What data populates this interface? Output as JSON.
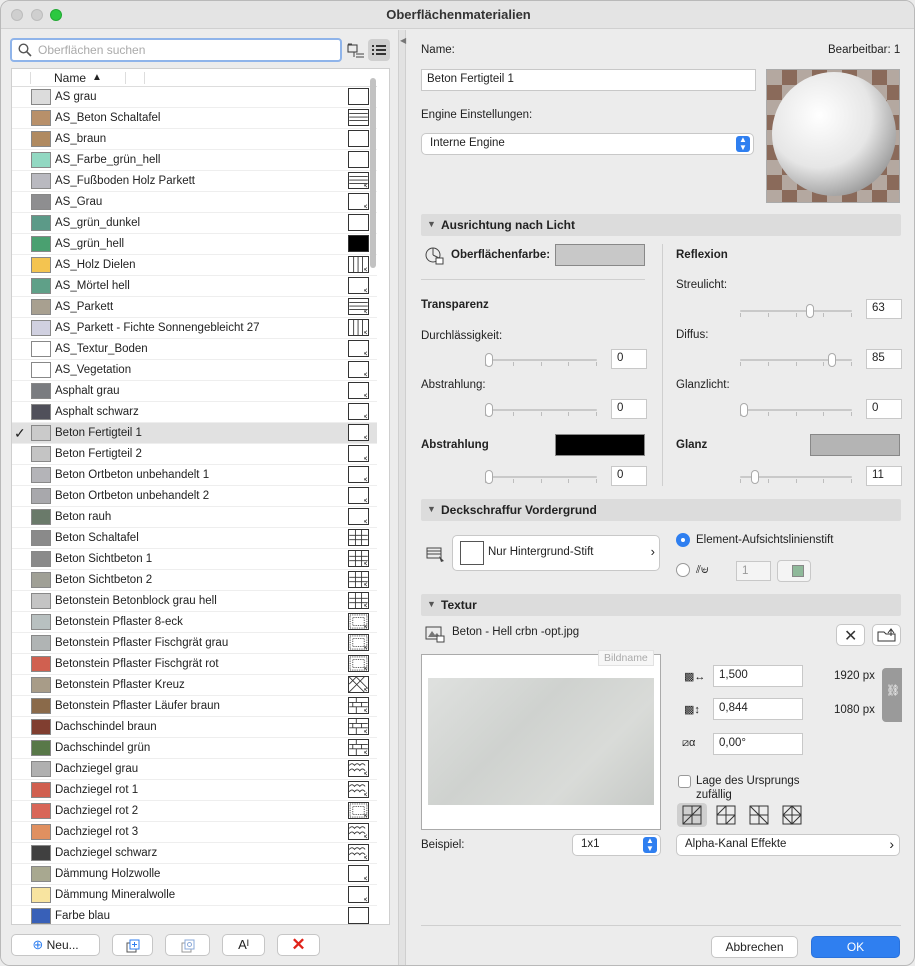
{
  "window": {
    "title": "Oberflächenmaterialien"
  },
  "search": {
    "placeholder": "Oberflächen suchen"
  },
  "list": {
    "column_name": "Name",
    "items": [
      {
        "name": "AS grau",
        "color": "#dcdcdc",
        "pattern": "empty"
      },
      {
        "name": "AS_Beton Schaltafel",
        "color": "#b8906a",
        "pattern": "hlines"
      },
      {
        "name": "AS_braun",
        "color": "#b08a60",
        "pattern": "empty"
      },
      {
        "name": "AS_Farbe_grün_hell",
        "color": "#92d8c2",
        "pattern": "empty"
      },
      {
        "name": "AS_Fußboden Holz Parkett",
        "color": "#b9b9c0",
        "pattern": "hlines-arrow"
      },
      {
        "name": "AS_Grau",
        "color": "#8e8e90",
        "pattern": "empty-arrow"
      },
      {
        "name": "AS_grün_dunkel",
        "color": "#5c9a88",
        "pattern": "empty"
      },
      {
        "name": "AS_grün_hell",
        "color": "#4aa070",
        "pattern": "black"
      },
      {
        "name": "AS_Holz Dielen",
        "color": "#f4c450",
        "pattern": "vlines-arrow"
      },
      {
        "name": "AS_Mörtel hell",
        "color": "#5fa088",
        "pattern": "empty-arrow"
      },
      {
        "name": "AS_Parkett",
        "color": "#a8a090",
        "pattern": "hlines-arrow"
      },
      {
        "name": "AS_Parkett - Fichte Sonnengebleicht 27",
        "color": "#d0d0e0",
        "pattern": "vlines-arrow"
      },
      {
        "name": "AS_Textur_Boden",
        "color": "#ffffff",
        "pattern": "empty-arrow"
      },
      {
        "name": "AS_Vegetation",
        "color": "#ffffff",
        "pattern": "empty-arrow"
      },
      {
        "name": "Asphalt grau",
        "color": "#7a7c80",
        "pattern": "empty-arrow"
      },
      {
        "name": "Asphalt schwarz",
        "color": "#50505a",
        "pattern": "empty-arrow"
      },
      {
        "name": "Beton Fertigteil 1",
        "color": "#cacaca",
        "pattern": "empty-arrow",
        "selected": true
      },
      {
        "name": "Beton Fertigteil 2",
        "color": "#c4c4c4",
        "pattern": "empty-arrow"
      },
      {
        "name": "Beton Ortbeton unbehandelt 1",
        "color": "#b4b4b8",
        "pattern": "empty-arrow"
      },
      {
        "name": "Beton Ortbeton unbehandelt 2",
        "color": "#a8a8ac",
        "pattern": "empty-arrow"
      },
      {
        "name": "Beton rauh",
        "color": "#6a7a6a",
        "pattern": "empty-arrow"
      },
      {
        "name": "Beton Schaltafel",
        "color": "#8a8a8a",
        "pattern": "grid"
      },
      {
        "name": "Beton Sichtbeton 1",
        "color": "#8a8a8a",
        "pattern": "grid-arrow"
      },
      {
        "name": "Beton Sichtbeton 2",
        "color": "#a0a096",
        "pattern": "grid-arrow"
      },
      {
        "name": "Betonstein Betonblock grau hell",
        "color": "#c4c4c4",
        "pattern": "grid-arrow"
      },
      {
        "name": "Betonstein Pflaster 8-eck",
        "color": "#b8c0c0",
        "pattern": "dense-arrow"
      },
      {
        "name": "Betonstein Pflaster Fischgrät grau",
        "color": "#b0b4b4",
        "pattern": "dense-arrow"
      },
      {
        "name": "Betonstein Pflaster Fischgrät rot",
        "color": "#d06050",
        "pattern": "dense-arrow"
      },
      {
        "name": "Betonstein Pflaster Kreuz",
        "color": "#a89c88",
        "pattern": "diag-arrow"
      },
      {
        "name": "Betonstein Pflaster Läufer braun",
        "color": "#8a6a4a",
        "pattern": "brick-arrow"
      },
      {
        "name": "Dachschindel braun",
        "color": "#803e30",
        "pattern": "brick-arrow"
      },
      {
        "name": "Dachschindel grün",
        "color": "#587848",
        "pattern": "brick-arrow"
      },
      {
        "name": "Dachziegel grau",
        "color": "#b0b0b0",
        "pattern": "tile-arrow"
      },
      {
        "name": "Dachziegel rot 1",
        "color": "#d06050",
        "pattern": "tile-arrow"
      },
      {
        "name": "Dachziegel rot 2",
        "color": "#d86658",
        "pattern": "dense-arrow"
      },
      {
        "name": "Dachziegel rot 3",
        "color": "#e09060",
        "pattern": "tile-arrow"
      },
      {
        "name": "Dachziegel schwarz",
        "color": "#404040",
        "pattern": "tile-arrow"
      },
      {
        "name": "Dämmung Holzwolle",
        "color": "#a8a890",
        "pattern": "empty-arrow"
      },
      {
        "name": "Dämmung Mineralwolle",
        "color": "#f8e4a0",
        "pattern": "empty-arrow"
      },
      {
        "name": "Farbe blau",
        "color": "#3860b8",
        "pattern": "empty"
      }
    ]
  },
  "bottom_bar": {
    "new_label": "Neu...",
    "new_icon": "plus-circle-icon",
    "duplicate_icon": "duplicate-icon",
    "import_icon": "import-icon",
    "rename_icon": "rename-icon",
    "delete_icon": "red-x-icon"
  },
  "details": {
    "name_label": "Name:",
    "editable_label": "Bearbeitbar: 1",
    "name_value": "Beton Fertigteil 1",
    "engine_label": "Engine Einstellungen:",
    "engine_value": "Interne Engine"
  },
  "light_section": {
    "title": "Ausrichtung nach Licht",
    "surface_color_label": "Oberflächenfarbe:",
    "surface_color": "#c8c8c8",
    "transparency_label": "Transparenz",
    "permeability_label": "Durchlässigkeit:",
    "permeability_value": "0",
    "permeability_level": 0,
    "emission_label": "Abstrahlung:",
    "emission_value": "0",
    "emission_level": 0,
    "radiation_label": "Abstrahlung",
    "radiation_color": "#000000",
    "radiation_value": "0",
    "radiation_level": 0,
    "reflection_label": "Reflexion",
    "scatter_label": "Streulicht:",
    "scatter_value": "63",
    "scatter_level": 63,
    "diffuse_label": "Diffus:",
    "diffuse_value": "85",
    "diffuse_level": 85,
    "highlight_label": "Glanzlicht:",
    "highlight_value": "0",
    "highlight_level": 0,
    "gloss_label": "Glanz",
    "gloss_color": "#b4b4b4",
    "gloss_value": "11",
    "gloss_level": 11
  },
  "hatch_section": {
    "title": "Deckschraffur Vordergrund",
    "pen_label": "Nur Hintergrund-Stift",
    "element_pen_label": "Element-Aufsichtslinienstift",
    "pen_number": "1",
    "pen_color": "#8fb99a"
  },
  "texture_section": {
    "title": "Textur",
    "file_name": "Beton - Hell crbn -opt.jpg",
    "image_name_tooltip": "Bildname",
    "width_value": "1,500",
    "height_value": "0,844",
    "angle_value": "0,00°",
    "width_px": "1920 px",
    "height_px": "1080 px",
    "random_origin_label": "Lage des Ursprungs zufällig",
    "example_label": "Beispiel:",
    "example_value": "1x1",
    "alpha_label": "Alpha-Kanal Effekte"
  },
  "footer": {
    "cancel_label": "Abbrechen",
    "ok_label": "OK"
  }
}
